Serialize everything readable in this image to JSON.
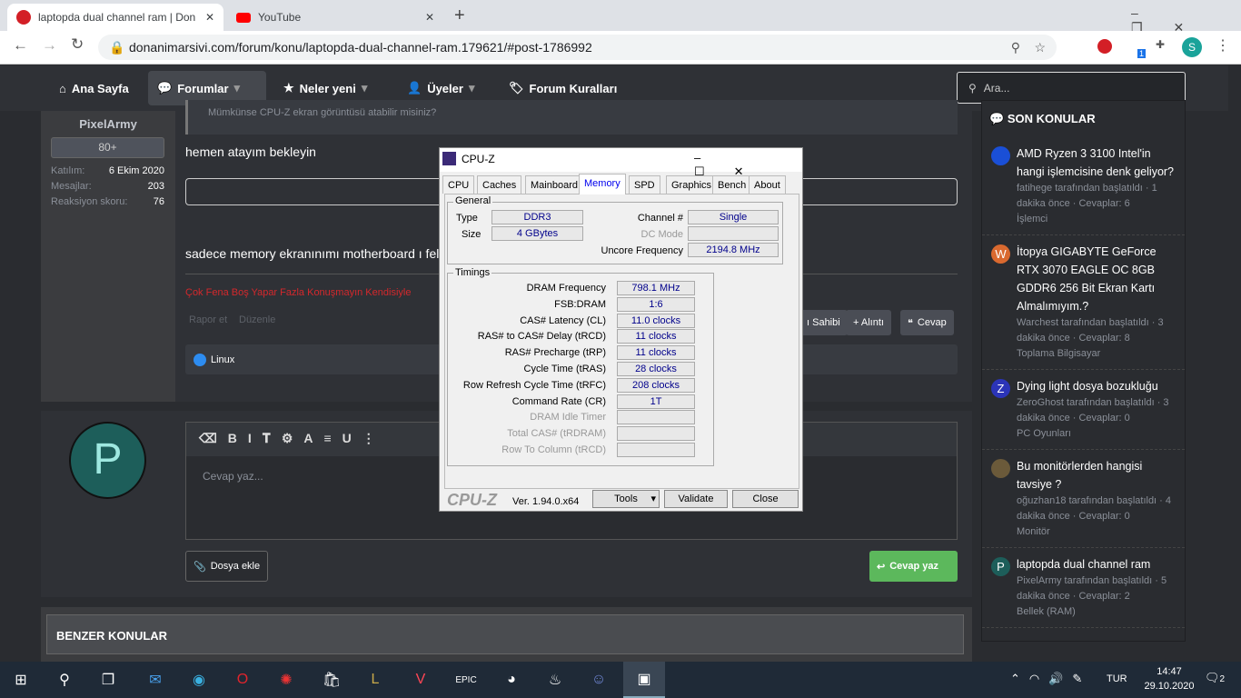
{
  "browser": {
    "tabs": [
      {
        "title": "laptopda dual channel ram | Don"
      },
      {
        "title": "YouTube"
      }
    ],
    "url": "donanimarsivi.com/forum/konu/laptopda-dual-channel-ram.179621/#post-1786992",
    "profile_initial": "S",
    "ext_badge": "1"
  },
  "nav": {
    "items": [
      "Ana Sayfa",
      "Forumlar",
      "Neler yeni",
      "Üyeler",
      "Forum Kuralları"
    ],
    "search_placeholder": "Ara..."
  },
  "post": {
    "username": "PixelArmy",
    "rank": "80+",
    "stats": [
      {
        "label": "Katılım:",
        "value": "6 Ekim 2020"
      },
      {
        "label": "Mesajlar:",
        "value": "203"
      },
      {
        "label": "Reaksiyon skoru:",
        "value": "76"
      }
    ],
    "quote": "Mümkünse CPU-Z ekran görüntüsü atabilir misiniz?",
    "text1": "hemen atayım bekleyin",
    "text2": "sadece memory ekranınımı motherboard ı felan",
    "signature": "Çok Fena Boş Yapar Fazla Konuşmayın Kendisiyle",
    "report": "Rapor et",
    "edit": "Düzenle",
    "owner": "ı Sahibi",
    "quote_btn": "+ Alıntı",
    "reply_btn": "Cevap",
    "reaction": "Linux"
  },
  "reply": {
    "avatar": "P",
    "placeholder": "Cevap yaz...",
    "attach": "Dosya ekle",
    "submit": "Cevap yaz"
  },
  "similar": {
    "title": "BENZER KONULAR"
  },
  "sidebar": {
    "title": "SON KONULAR",
    "items": [
      {
        "avatar": "",
        "color": "#1a4fd6",
        "title": "AMD Ryzen 3 3100 Intel'in hangi işlemcisine denk geliyor?",
        "meta": "fatihege tarafından başlatıldı · 1 dakika önce · Cevaplar: 6",
        "cat": "İşlemci"
      },
      {
        "avatar": "W",
        "color": "#d9692f",
        "title": "İtopya GIGABYTE GeForce RTX 3070 EAGLE OC 8GB GDDR6 256 Bit Ekran Kartı Almalımıyım.?",
        "meta": "Warchest tarafından başlatıldı · 3 dakika önce · Cevaplar: 8",
        "cat": "Toplama Bilgisayar"
      },
      {
        "avatar": "Z",
        "color": "#2b34b8",
        "title": "Dying light dosya bozukluğu",
        "meta": "ZeroGhost tarafından başlatıldı · 3 dakika önce · Cevaplar: 0",
        "cat": "PC Oyunları"
      },
      {
        "avatar": "",
        "color": "#6b5a3a",
        "title": "Bu monitörlerden hangisi tavsiye ?",
        "meta": "oğuzhan18 tarafından başlatıldı · 4 dakika önce · Cevaplar: 0",
        "cat": "Monitör"
      },
      {
        "avatar": "P",
        "color": "#1d5e5a",
        "title": "laptopda dual channel ram",
        "meta": "PixelArmy tarafından başlatıldı · 5 dakika önce · Cevaplar: 2",
        "cat": "Bellek (RAM)"
      }
    ]
  },
  "cpuz": {
    "title": "CPU-Z",
    "tabs": [
      "CPU",
      "Caches",
      "Mainboard",
      "Memory",
      "SPD",
      "Graphics",
      "Bench",
      "About"
    ],
    "active_tab": "Memory",
    "general_label": "General",
    "type_label": "Type",
    "type": "DDR3",
    "size_label": "Size",
    "size": "4 GBytes",
    "channel_label": "Channel #",
    "channel": "Single",
    "dc_label": "DC Mode",
    "uncore_label": "Uncore Frequency",
    "uncore": "2194.8 MHz",
    "timings_label": "Timings",
    "timings": [
      {
        "label": "DRAM Frequency",
        "value": "798.1 MHz"
      },
      {
        "label": "FSB:DRAM",
        "value": "1:6"
      },
      {
        "label": "CAS# Latency (CL)",
        "value": "11.0 clocks"
      },
      {
        "label": "RAS# to CAS# Delay (tRCD)",
        "value": "11 clocks"
      },
      {
        "label": "RAS# Precharge (tRP)",
        "value": "11 clocks"
      },
      {
        "label": "Cycle Time (tRAS)",
        "value": "28 clocks"
      },
      {
        "label": "Row Refresh Cycle Time (tRFC)",
        "value": "208 clocks"
      },
      {
        "label": "Command Rate (CR)",
        "value": "1T"
      },
      {
        "label": "DRAM Idle Timer",
        "value": ""
      },
      {
        "label": "Total CAS# (tRDRAM)",
        "value": ""
      },
      {
        "label": "Row To Column (tRCD)",
        "value": ""
      }
    ],
    "brand": "CPU-Z",
    "version": "Ver. 1.94.0.x64",
    "tools": "Tools",
    "validate": "Validate",
    "close": "Close"
  },
  "taskbar": {
    "lang": "TUR",
    "time": "14:47",
    "date": "29.10.2020",
    "notif": "2"
  }
}
